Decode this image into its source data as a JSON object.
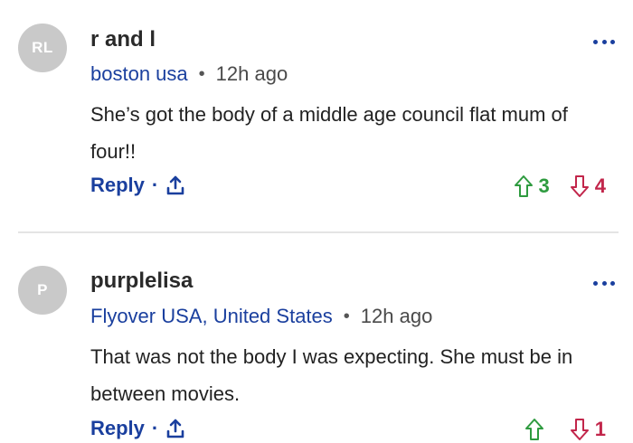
{
  "colors": {
    "link_blue": "#1a3f9e",
    "upvote_green": "#2e9b3f",
    "downvote_red": "#c2264b",
    "avatar_gray": "#c9c9c9"
  },
  "comments": [
    {
      "avatar_initials": "RL",
      "username": "r and l",
      "location": "boston usa",
      "time": "12h ago",
      "body": "She’s got the body of a middle age council flat mum of four!!",
      "reply_label": "Reply",
      "upvotes": "3",
      "downvotes": "4",
      "icons": [
        "more-options-icon",
        "share-icon",
        "upvote-arrow-icon",
        "downvote-arrow-icon"
      ]
    },
    {
      "avatar_initials": "P",
      "username": "purplelisa",
      "location": "Flyover USA, United States",
      "time": "12h ago",
      "body": "That was not the body I was expecting. She must be in between movies.",
      "reply_label": "Reply",
      "upvotes": "",
      "downvotes": "1",
      "icons": [
        "more-options-icon",
        "share-icon",
        "upvote-arrow-icon",
        "downvote-arrow-icon"
      ]
    }
  ]
}
